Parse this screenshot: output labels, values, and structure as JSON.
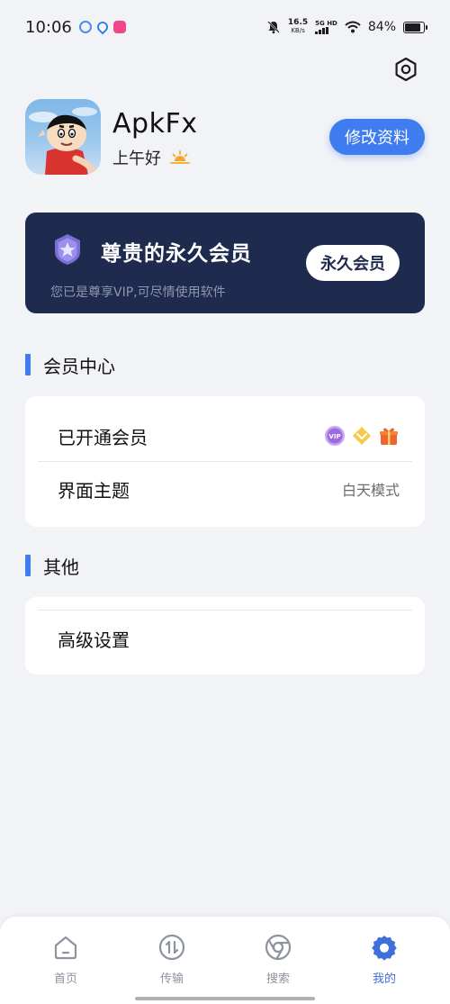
{
  "status_bar": {
    "time": "10:06",
    "net_speed": "16.5",
    "net_unit": "KB/s",
    "signal_label": "5G HD",
    "battery": "84%",
    "battery_level": 0.84
  },
  "profile": {
    "username": "ApkFx",
    "greeting": "上午好",
    "edit_button": "修改资料"
  },
  "vip_card": {
    "title": "尊贵的永久会员",
    "subtitle": "您已是尊享VIP,可尽情使用软件",
    "badge": "永久会员"
  },
  "sections": {
    "member_center": {
      "title": "会员中心",
      "rows": [
        {
          "label": "已开通会员",
          "icons": [
            "vip-icon",
            "diamond-icon",
            "gift-icon"
          ]
        },
        {
          "label": "界面主题",
          "value": "白天模式"
        }
      ]
    },
    "other": {
      "title": "其他",
      "rows": [
        {
          "label": "高级设置"
        }
      ]
    }
  },
  "bottom_nav": {
    "items": [
      {
        "label": "首页",
        "icon": "home-icon",
        "active": false
      },
      {
        "label": "传输",
        "icon": "transfer-icon",
        "active": false
      },
      {
        "label": "搜索",
        "icon": "browser-icon",
        "active": false
      },
      {
        "label": "我的",
        "icon": "settings-icon",
        "active": true
      }
    ]
  },
  "colors": {
    "accent": "#3f7cf0",
    "vip_card_bg": "#1e2a4e",
    "page_bg": "#f2f3f6",
    "nav_active": "#3f6fd8",
    "nav_inactive": "#8e93a0"
  }
}
